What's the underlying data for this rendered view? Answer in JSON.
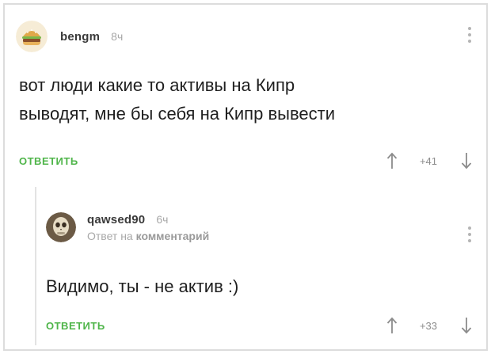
{
  "comments": [
    {
      "username": "bengm",
      "time": "8ч",
      "text_line1": "вот люди какие то активы на Кипр",
      "text_line2": "выводят, мне бы себя на Кипр вывести",
      "reply_label": "ОТВЕТИТЬ",
      "rating": "+41",
      "avatar_icon": "hamburger-avatar-icon"
    },
    {
      "username": "qawsed90",
      "time": "6ч",
      "reply_prefix": "Ответ на",
      "reply_target": "комментарий",
      "text": "Видимо, ты - не актив :)",
      "reply_label": "ОТВЕТИТЬ",
      "rating": "+33",
      "avatar_icon": "skull-avatar-icon"
    }
  ],
  "colors": {
    "accent_green": "#4fb54a",
    "muted_gray": "#a8a8a8",
    "text": "#1f1f1f"
  }
}
